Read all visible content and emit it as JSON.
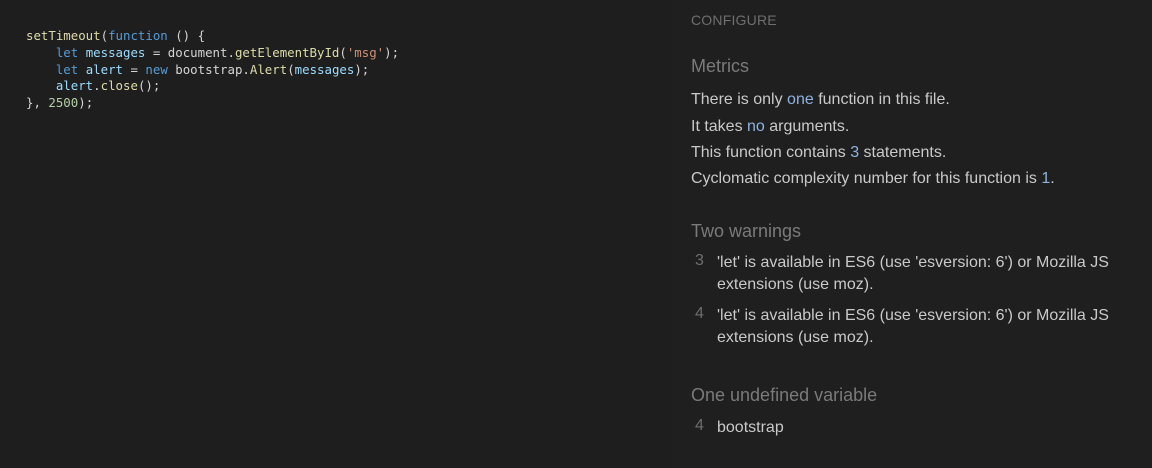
{
  "code": {
    "lines": [
      "setTimeout(function () {",
      "    let messages = document.getElementById('msg');",
      "    let alert = new bootstrap.Alert(messages);",
      "    alert.close();",
      "}, 2500);"
    ]
  },
  "panel": {
    "configure_label": "CONFIGURE",
    "metrics": {
      "title": "Metrics",
      "function_count": {
        "prefix": "There is only ",
        "value": "one",
        "suffix": " function in this file."
      },
      "arguments": {
        "prefix": "It takes ",
        "value": "no",
        "suffix": " arguments."
      },
      "statements": {
        "prefix": "This function contains ",
        "value": "3",
        "suffix": " statements."
      },
      "complexity": {
        "prefix": "Cyclomatic complexity number for this function is ",
        "value": "1",
        "suffix": "."
      }
    },
    "warnings": {
      "title": "Two warnings",
      "items": [
        {
          "line": "3",
          "text": "'let' is available in ES6 (use 'esversion: 6') or Mozilla JS extensions (use moz)."
        },
        {
          "line": "4",
          "text": "'let' is available in ES6 (use 'esversion: 6') or Mozilla JS extensions (use moz)."
        }
      ]
    },
    "undefined": {
      "title": "One undefined variable",
      "items": [
        {
          "line": "4",
          "name": "bootstrap"
        }
      ]
    }
  }
}
